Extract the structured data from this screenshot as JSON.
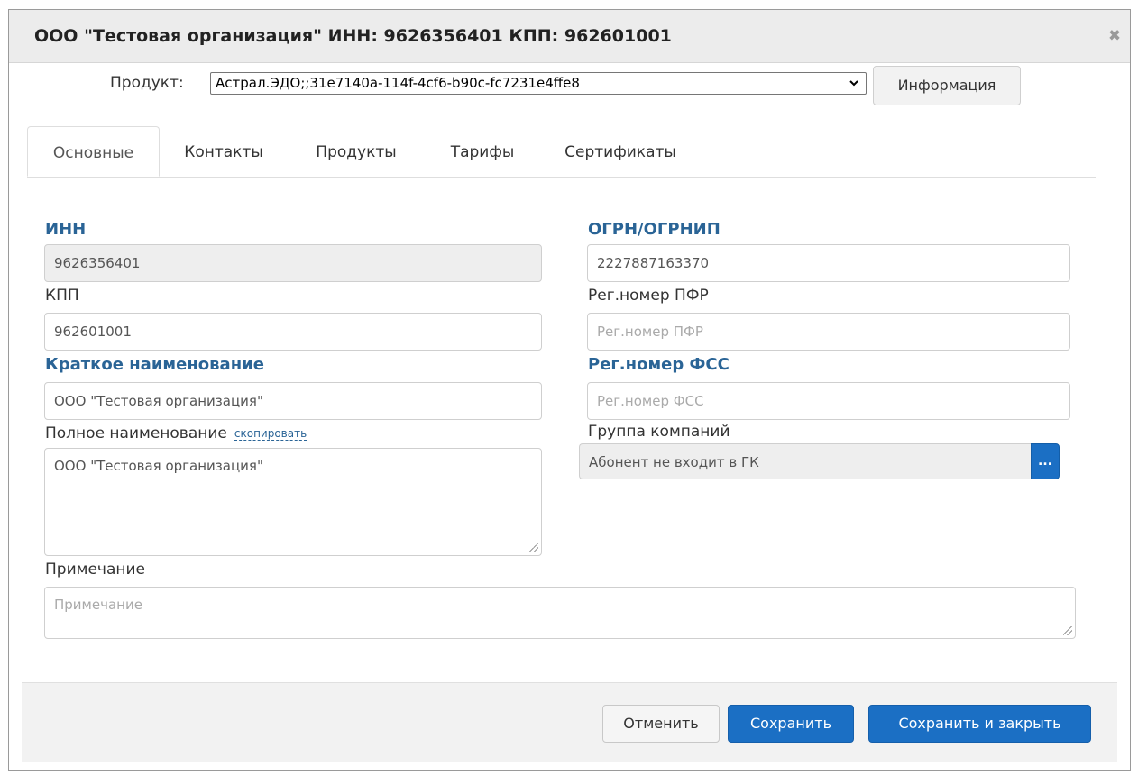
{
  "dialog": {
    "title": "ООО \"Тестовая организация\" ИНН: 9626356401 КПП: 962601001",
    "close_glyph": "✖"
  },
  "product": {
    "label": "Продукт:",
    "selected": "Астрал.ЭДО;;31e7140a-114f-4cf6-b90c-fc7231e4ffe8",
    "info_button": "Информация"
  },
  "tabs": [
    "Основные",
    "Контакты",
    "Продукты",
    "Тарифы",
    "Сертификаты"
  ],
  "form": {
    "inn": {
      "label": "ИНН",
      "value": "9626356401"
    },
    "ogrn": {
      "label": "ОГРН/ОГРНИП",
      "value": "2227887163370"
    },
    "kpp": {
      "label": "КПП",
      "value": "962601001"
    },
    "pfr": {
      "label": "Рег.номер ПФР",
      "placeholder": "Рег.номер ПФР"
    },
    "short_name": {
      "label": "Краткое наименование",
      "value": "ООО \"Тестовая организация\""
    },
    "fss": {
      "label": "Рег.номер ФСС",
      "placeholder": "Рег.номер ФСС"
    },
    "full_name": {
      "label": "Полное наименование",
      "copy_link": "скопировать",
      "value": "ООО \"Тестовая организация\""
    },
    "company_group": {
      "label": "Группа компаний",
      "value": "Абонент не входит в ГК",
      "button": "..."
    },
    "note": {
      "label": "Примечание",
      "placeholder": "Примечание"
    }
  },
  "footer": {
    "cancel": "Отменить",
    "save": "Сохранить",
    "save_close": "Сохранить и закрыть"
  }
}
